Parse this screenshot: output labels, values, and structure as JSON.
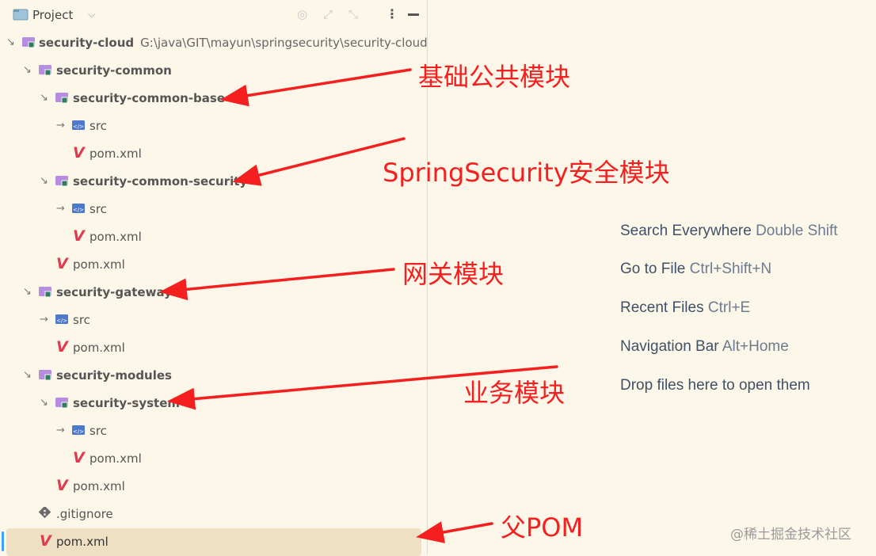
{
  "header": {
    "title": "Project",
    "chevron_icon": "chevron-down-icon",
    "tools": [
      "target-icon",
      "expand-icon",
      "collapse-icon",
      "more-icon",
      "minimize-icon"
    ]
  },
  "tree": {
    "root": {
      "name": "security-cloud",
      "path": "G:\\java\\GIT\\mayun\\springsecurity\\security-cloud"
    },
    "common": {
      "name": "security-common"
    },
    "common_base": {
      "name": "security-common-base",
      "src": "src",
      "pom": "pom.xml"
    },
    "common_security": {
      "name": "security-common-security",
      "src": "src",
      "pom": "pom.xml"
    },
    "common_pom": "pom.xml",
    "gateway": {
      "name": "security-gateway",
      "src": "src",
      "pom": "pom.xml"
    },
    "modules": {
      "name": "security-modules"
    },
    "system": {
      "name": "security-system",
      "src": "src",
      "pom": "pom.xml"
    },
    "modules_pom": "pom.xml",
    "gitignore": ".gitignore",
    "root_pom": "pom.xml"
  },
  "hints": [
    {
      "action": "Search Everywhere",
      "key": "Double Shift"
    },
    {
      "action": "Go to File",
      "key": "Ctrl+Shift+N"
    },
    {
      "action": "Recent Files",
      "key": "Ctrl+E"
    },
    {
      "action": "Navigation Bar",
      "key": "Alt+Home"
    },
    {
      "action": "Drop files here to open them",
      "key": ""
    }
  ],
  "annotations": {
    "common_base": "基础公共模块",
    "common_security": "SpringSecurity安全模块",
    "gateway": "网关模块",
    "system": "业务模块",
    "parent_pom": "父POM"
  },
  "watermark": "@稀土掘金技术社区",
  "colors": {
    "background": "#fdf7e9",
    "selection": "#efe0c4",
    "annotation": "#f51f1f",
    "maven_icon": "#e13a4f",
    "module_folder": "#b58ce0",
    "src_folder": "#4d78cc"
  }
}
